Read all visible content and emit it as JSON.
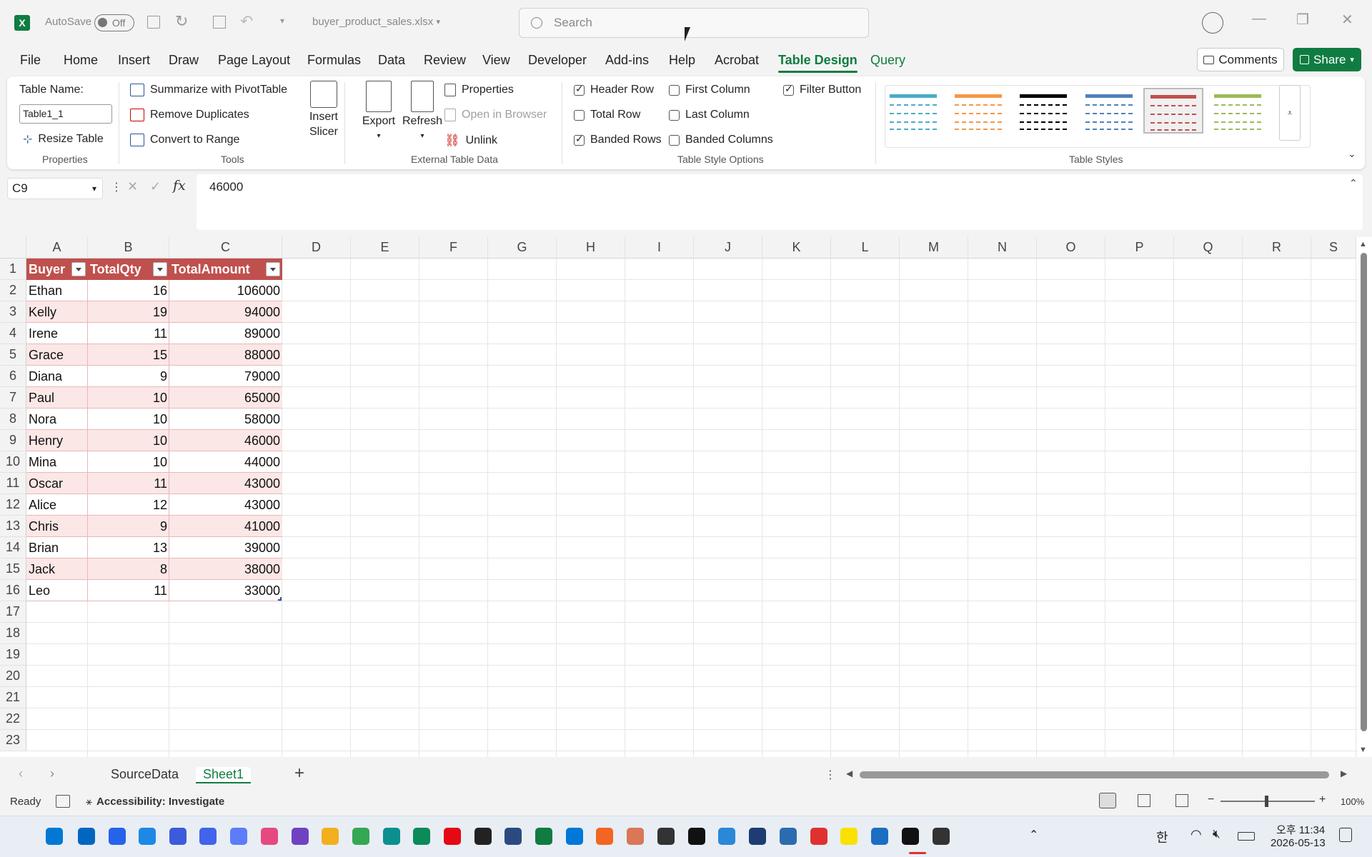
{
  "titlebar": {
    "autosave_label": "AutoSave",
    "autosave_state": "Off",
    "filename": "buyer_product_sales.xlsx",
    "search_placeholder": "Search"
  },
  "menu": {
    "tabs": [
      "File",
      "Home",
      "Insert",
      "Draw",
      "Page Layout",
      "Formulas",
      "Data",
      "Review",
      "View",
      "Developer",
      "Add-ins",
      "Help",
      "Acrobat",
      "Table Design",
      "Query"
    ],
    "active": "Table Design",
    "comments": "Comments",
    "share": "Share"
  },
  "ribbon": {
    "properties": {
      "table_name_label": "Table Name:",
      "table_name_value": "Table1_1",
      "resize": "Resize Table",
      "group": "Properties"
    },
    "tools": {
      "pivot": "Summarize with PivotTable",
      "dupes": "Remove Duplicates",
      "convert": "Convert to Range",
      "slicer_line1": "Insert",
      "slicer_line2": "Slicer",
      "group": "Tools"
    },
    "external": {
      "export": "Export",
      "refresh": "Refresh",
      "properties": "Properties",
      "open_browser": "Open in Browser",
      "unlink": "Unlink",
      "group": "External Table Data"
    },
    "style_options": {
      "header_row": "Header Row",
      "total_row": "Total Row",
      "banded_rows": "Banded Rows",
      "first_column": "First Column",
      "last_column": "Last Column",
      "banded_columns": "Banded Columns",
      "filter_button": "Filter Button",
      "group": "Table Style Options",
      "checked": {
        "header_row": true,
        "total_row": false,
        "banded_rows": true,
        "first_column": false,
        "last_column": false,
        "banded_columns": false,
        "filter_button": true
      }
    },
    "styles": {
      "group": "Table Styles",
      "swatches": [
        "#4bacc6",
        "#f79646",
        "#000000",
        "#4f81bd",
        "#c0504d",
        "#9bbb59"
      ],
      "selected_index": 4
    }
  },
  "formula_bar": {
    "cell_ref": "C9",
    "fx": "fx",
    "value": "46000"
  },
  "grid": {
    "columns": [
      "A",
      "B",
      "C",
      "D",
      "E",
      "F",
      "G",
      "H",
      "I",
      "J",
      "K",
      "L",
      "M",
      "N",
      "O",
      "P",
      "Q",
      "R",
      "S"
    ],
    "rows": [
      "1",
      "2",
      "3",
      "4",
      "5",
      "6",
      "7",
      "8",
      "9",
      "10",
      "11",
      "12",
      "13",
      "14",
      "15",
      "16",
      "17",
      "18",
      "19",
      "20",
      "21",
      "22",
      "23"
    ],
    "table": {
      "headers": [
        "Buyer",
        "TotalQty",
        "TotalAmount"
      ],
      "rows": [
        [
          "Ethan",
          "16",
          "106000"
        ],
        [
          "Kelly",
          "19",
          "94000"
        ],
        [
          "Irene",
          "11",
          "89000"
        ],
        [
          "Grace",
          "15",
          "88000"
        ],
        [
          "Diana",
          "9",
          "79000"
        ],
        [
          "Paul",
          "10",
          "65000"
        ],
        [
          "Nora",
          "10",
          "58000"
        ],
        [
          "Henry",
          "10",
          "46000"
        ],
        [
          "Mina",
          "10",
          "44000"
        ],
        [
          "Oscar",
          "11",
          "43000"
        ],
        [
          "Alice",
          "12",
          "43000"
        ],
        [
          "Chris",
          "9",
          "41000"
        ],
        [
          "Brian",
          "13",
          "39000"
        ],
        [
          "Jack",
          "8",
          "38000"
        ],
        [
          "Leo",
          "11",
          "33000"
        ]
      ],
      "header_color": "#c0504d",
      "band_color": "#fbe7e6"
    }
  },
  "sheets": {
    "tabs": [
      "SourceData",
      "Sheet1"
    ],
    "active": "Sheet1",
    "add": "+"
  },
  "status": {
    "ready": "Ready",
    "accessibility": "Accessibility: Investigate",
    "zoom": "100%"
  },
  "taskbar": {
    "time": "오후 11:34",
    "date": "2026-05-13",
    "ime": "한"
  },
  "colors": {
    "accent": "#107c41"
  }
}
